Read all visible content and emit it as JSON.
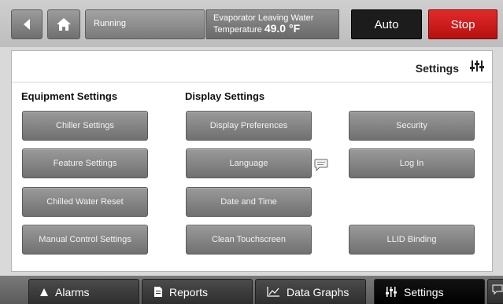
{
  "header": {
    "status": "Running",
    "evap_label": "Evaporator Leaving Water",
    "evap_label2": "Temperature",
    "evap_value": "49.0 °F",
    "auto_label": "Auto",
    "stop_label": "Stop"
  },
  "page": {
    "title": "Settings"
  },
  "sections": {
    "equipment": "Equipment Settings",
    "display": "Display Settings"
  },
  "buttons": {
    "chiller_settings": "Chiller Settings",
    "feature_settings": "Feature Settings",
    "chilled_water_reset": "Chilled Water Reset",
    "manual_control_settings": "Manual Control Settings",
    "display_preferences": "Display Preferences",
    "language": "Language",
    "date_and_time": "Date and Time",
    "clean_touchscreen": "Clean Touchscreen",
    "security": "Security",
    "log_in": "Log In",
    "llid_binding": "LLID Binding"
  },
  "tabs": [
    {
      "label": "Alarms",
      "icon": "bell-icon"
    },
    {
      "label": "Reports",
      "icon": "report-icon"
    },
    {
      "label": "Data Graphs",
      "icon": "graph-icon"
    },
    {
      "label": "Settings",
      "icon": "settings-sliders-icon",
      "active": true
    }
  ],
  "colors": {
    "stop": "#c8191b",
    "auto": "#1c1c1c",
    "button": "#858585",
    "active_tab": "#000000"
  }
}
